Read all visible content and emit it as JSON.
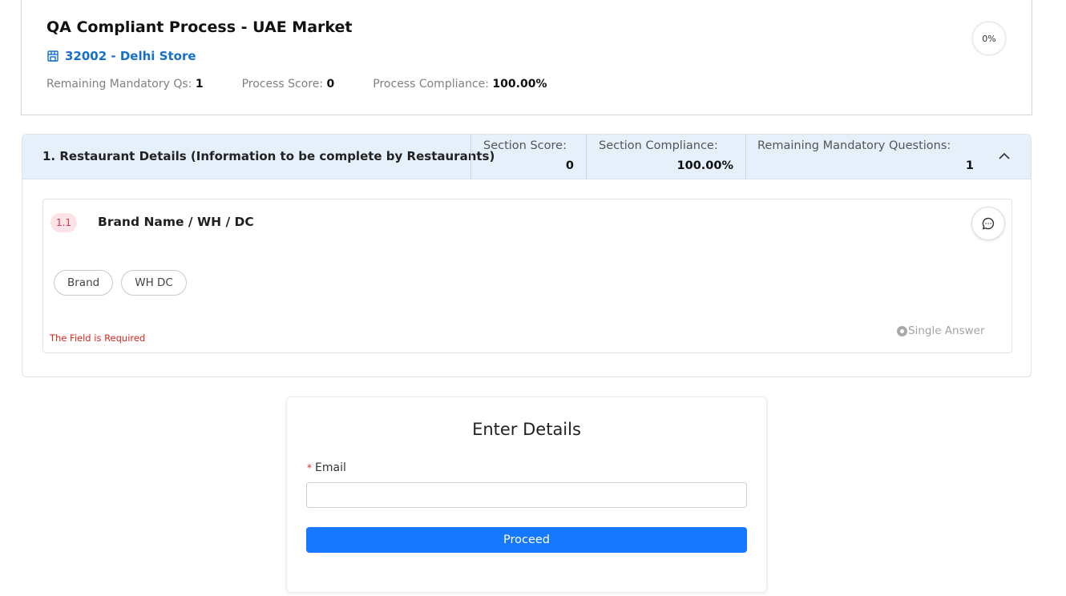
{
  "header": {
    "title": "QA Compliant Process - UAE Market",
    "store": "32002 - Delhi Store",
    "progress": "0%",
    "stats": [
      {
        "label": "Remaining Mandatory Qs:",
        "value": "1"
      },
      {
        "label": "Process Score:",
        "value": "0"
      },
      {
        "label": "Process Compliance:",
        "value": "100.00%"
      }
    ]
  },
  "section": {
    "title": "1. Restaurant Details (Information to be complete by Restaurants)",
    "score_label": "Section Score:",
    "score_value": "0",
    "compliance_label": "Section Compliance:",
    "compliance_value": "100.00%",
    "remaining_label": "Remaining Mandatory Questions:",
    "remaining_value": "1"
  },
  "question": {
    "number": "1.1",
    "title": "Brand Name / WH / DC",
    "options": [
      "Brand",
      "WH DC"
    ],
    "error": "The Field is Required",
    "answer_type": "Single Answer"
  },
  "details": {
    "title": "Enter Details",
    "email_label": "Email",
    "required_mark": "*",
    "email_value": "",
    "proceed_label": "Proceed"
  },
  "colors": {
    "accent": "#1677ff",
    "link": "#1670c9",
    "error": "#e0271f",
    "section_header_bg": "#e6f0fa",
    "badge_bg": "#fde3e7"
  }
}
